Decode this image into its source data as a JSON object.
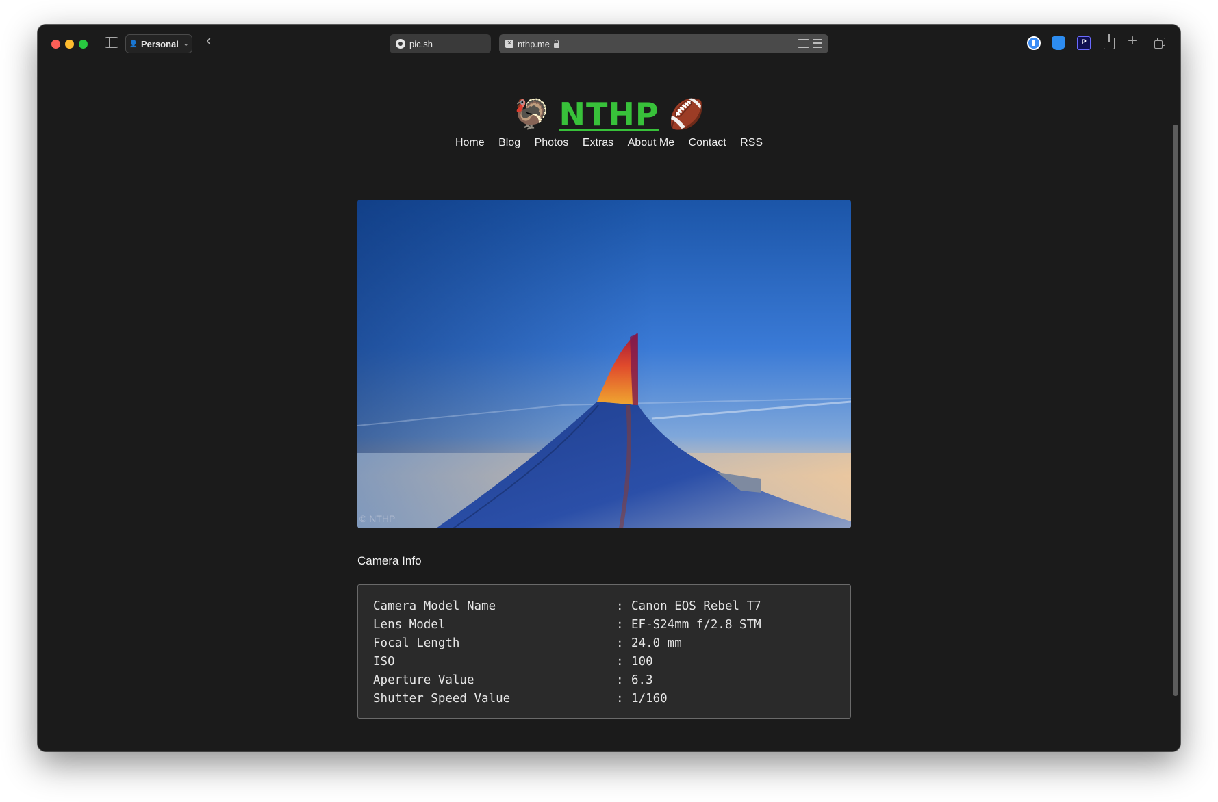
{
  "browser": {
    "profile_label": "Personal",
    "tabs": [
      {
        "label": "pic.sh"
      },
      {
        "label": "nthp.me"
      }
    ]
  },
  "site": {
    "brand_left_emoji": "🦃",
    "brand_title": "NTHP",
    "brand_right_emoji": "🏈",
    "nav": [
      "Home",
      "Blog",
      "Photos",
      "Extras",
      "About Me",
      "Contact",
      "RSS"
    ],
    "photo_watermark": "© NTHP"
  },
  "camera_info": {
    "title": "Camera Info",
    "rows": [
      {
        "key": "Camera Model Name",
        "value": "Canon EOS Rebel T7"
      },
      {
        "key": "Lens Model",
        "value": "EF-S24mm f/2.8 STM"
      },
      {
        "key": "Focal Length",
        "value": "24.0 mm"
      },
      {
        "key": "ISO",
        "value": "100"
      },
      {
        "key": "Aperture Value",
        "value": "6.3"
      },
      {
        "key": "Shutter Speed Value",
        "value": "1/160"
      }
    ]
  },
  "colors": {
    "brand_green": "#38c13a",
    "page_background": "#1b1b1b"
  }
}
